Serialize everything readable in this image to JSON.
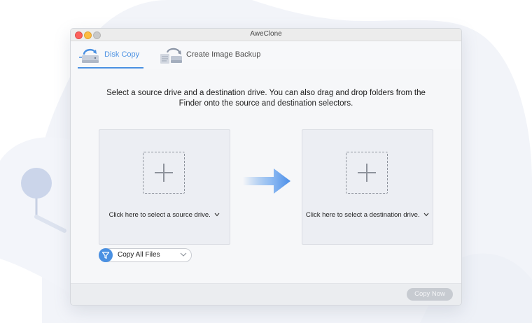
{
  "window": {
    "title": "AweClone"
  },
  "tabs": [
    {
      "label": "Disk Copy",
      "icon": "disk-copy-icon",
      "active": true
    },
    {
      "label": "Create Image Backup",
      "icon": "image-backup-icon",
      "active": false
    }
  ],
  "main": {
    "instructions": "Select a source drive and a destination drive. You can also drag and drop folders from the Finder onto the source and destination selectors.",
    "source": {
      "caption": "Click here to select a source drive.",
      "icon": "plus-icon"
    },
    "destination": {
      "caption": "Click here to select a destination drive.",
      "icon": "plus-icon"
    },
    "arrow_icon": "arrow-right-icon",
    "filter": {
      "selected": "Copy All Files",
      "icon": "filter-icon"
    }
  },
  "footer": {
    "copy_now_label": "Copy Now"
  },
  "colors": {
    "accent": "#4a90e2",
    "close": "#fc605c",
    "minimize": "#fdbc40",
    "maximize": "#c9c9c9",
    "disabled_button": "#c7cbd1"
  }
}
